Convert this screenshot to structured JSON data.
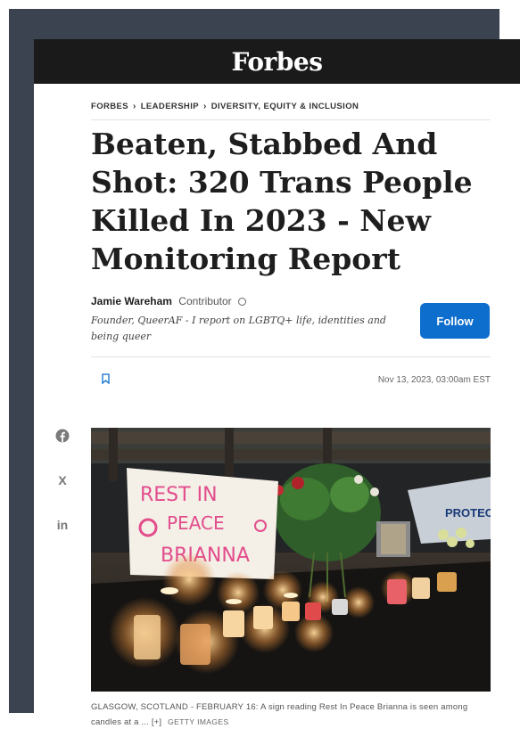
{
  "masthead": {
    "logo": "Forbes"
  },
  "breadcrumb": {
    "items": [
      "FORBES",
      "LEADERSHIP",
      "DIVERSITY, EQUITY & INCLUSION"
    ]
  },
  "article": {
    "headline": "Beaten, Stabbed And Shot: 320 Trans People Killed In 2023 - New Monitoring Report",
    "author": {
      "name": "Jamie Wareham",
      "role": "Contributor",
      "bio": "Founder, QueerAF - I report on LGBTQ+ life, identities and being queer",
      "follow_label": "Follow"
    },
    "date": "Nov 13, 2023, 03:00am EST"
  },
  "share": {
    "icons": [
      "facebook-icon",
      "x-icon",
      "linkedin-icon"
    ],
    "x_label": "X",
    "linkedin_label": "in"
  },
  "image": {
    "sign_lines": [
      "REST IN",
      "PEACE",
      "BRIANNA"
    ],
    "protest_sign": "PROTECT"
  },
  "caption": {
    "text": "GLASGOW, SCOTLAND - FEBRUARY 16: A sign reading Rest In Peace Brianna is seen among candles at a ...",
    "expand": "[+]",
    "credit": "GETTY IMAGES"
  },
  "colors": {
    "backdrop": "#3b4250",
    "masthead": "#1a1a1a",
    "follow": "#0d6ecd",
    "link_blue": "#0d6ecd"
  }
}
